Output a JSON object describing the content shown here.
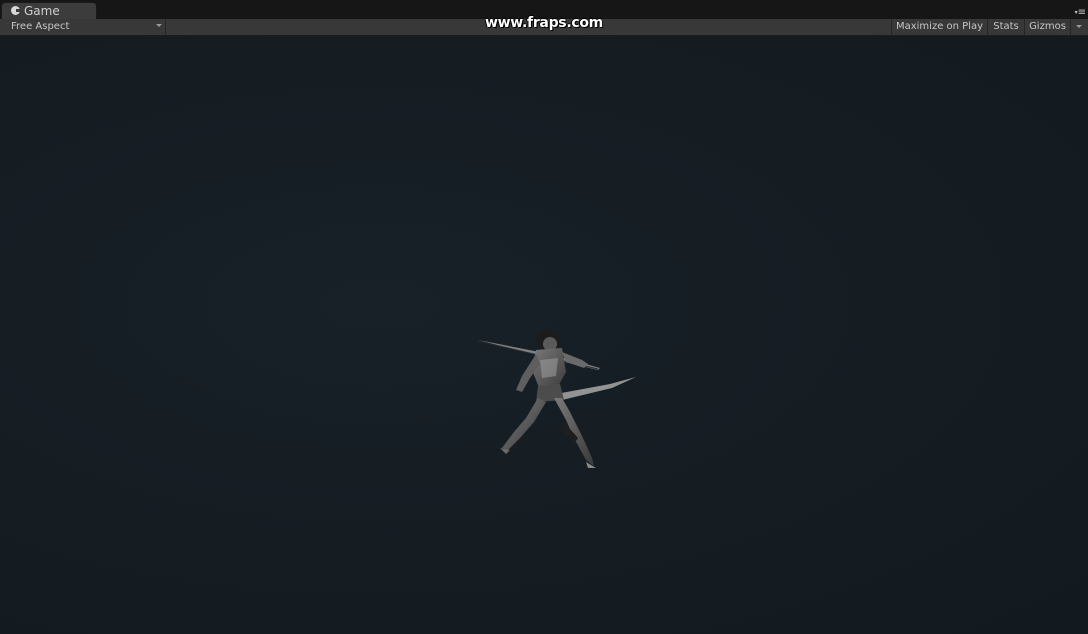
{
  "tabbar": {
    "tab_label": "Game",
    "tab_icon": "pacman-icon",
    "menu_icon": "panel-menu-icon"
  },
  "toolbar": {
    "aspect_label": "Free Aspect",
    "maximize_label": "Maximize on Play",
    "stats_label": "Stats",
    "gizmos_label": "Gizmos"
  },
  "overlay": {
    "watermark": "www.fraps.com"
  },
  "colors": {
    "background": "#141c22",
    "toolbar": "#383838",
    "tab": "#3c3c3c"
  }
}
